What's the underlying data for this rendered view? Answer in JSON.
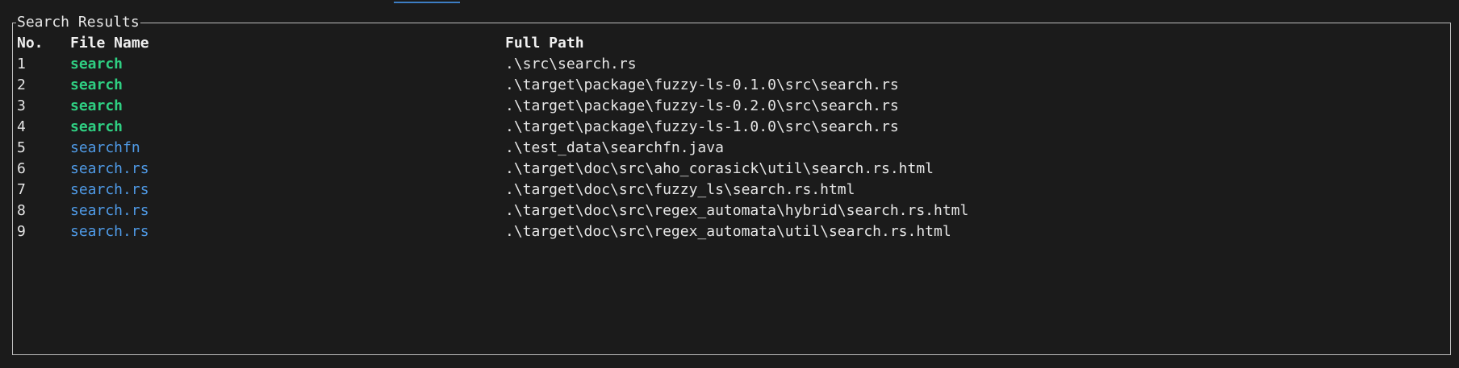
{
  "panel": {
    "title": "Search Results"
  },
  "table": {
    "headers": {
      "no": "No.",
      "file_name": "File Name",
      "full_path": "Full Path"
    },
    "rows": [
      {
        "no": "1",
        "file_name": "search",
        "full_path": ".\\src\\search.rs",
        "match": "exact"
      },
      {
        "no": "2",
        "file_name": "search",
        "full_path": ".\\target\\package\\fuzzy-ls-0.1.0\\src\\search.rs",
        "match": "exact"
      },
      {
        "no": "3",
        "file_name": "search",
        "full_path": ".\\target\\package\\fuzzy-ls-0.2.0\\src\\search.rs",
        "match": "exact"
      },
      {
        "no": "4",
        "file_name": "search",
        "full_path": ".\\target\\package\\fuzzy-ls-1.0.0\\src\\search.rs",
        "match": "exact"
      },
      {
        "no": "5",
        "file_name": "searchfn",
        "full_path": ".\\test_data\\searchfn.java",
        "match": "partial"
      },
      {
        "no": "6",
        "file_name": "search.rs",
        "full_path": ".\\target\\doc\\src\\aho_corasick\\util\\search.rs.html",
        "match": "partial"
      },
      {
        "no": "7",
        "file_name": "search.rs",
        "full_path": ".\\target\\doc\\src\\fuzzy_ls\\search.rs.html",
        "match": "partial"
      },
      {
        "no": "8",
        "file_name": "search.rs",
        "full_path": ".\\target\\doc\\src\\regex_automata\\hybrid\\search.rs.html",
        "match": "partial"
      },
      {
        "no": "9",
        "file_name": "search.rs",
        "full_path": ".\\target\\doc\\src\\regex_automata\\util\\search.rs.html",
        "match": "partial"
      }
    ]
  },
  "colors": {
    "background": "#1b1b1b",
    "border": "#bdbdbd",
    "text": "#e6e6e6",
    "exact_match": "#2fcf82",
    "partial_match": "#4f9ae6",
    "tab_indicator": "#3d7ec4"
  }
}
